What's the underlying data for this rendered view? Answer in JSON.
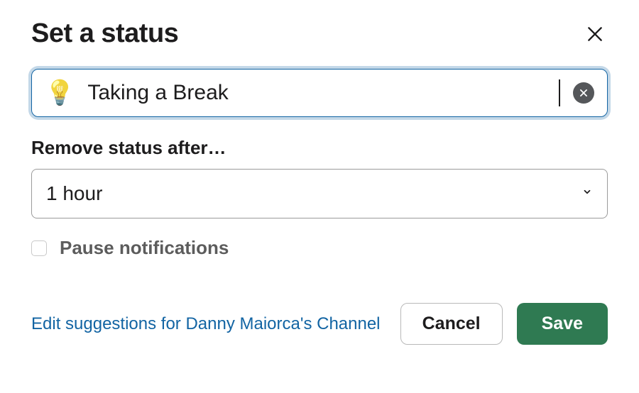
{
  "dialog": {
    "title": "Set a status",
    "status": {
      "emoji": "💡",
      "value": "Taking a Break"
    },
    "remove_after": {
      "label": "Remove status after…",
      "selected": "1 hour"
    },
    "pause": {
      "checked": false,
      "label": "Pause notifications"
    },
    "footer": {
      "edit_link": "Edit suggestions for Danny Maiorca's Channel",
      "cancel": "Cancel",
      "save": "Save"
    }
  }
}
